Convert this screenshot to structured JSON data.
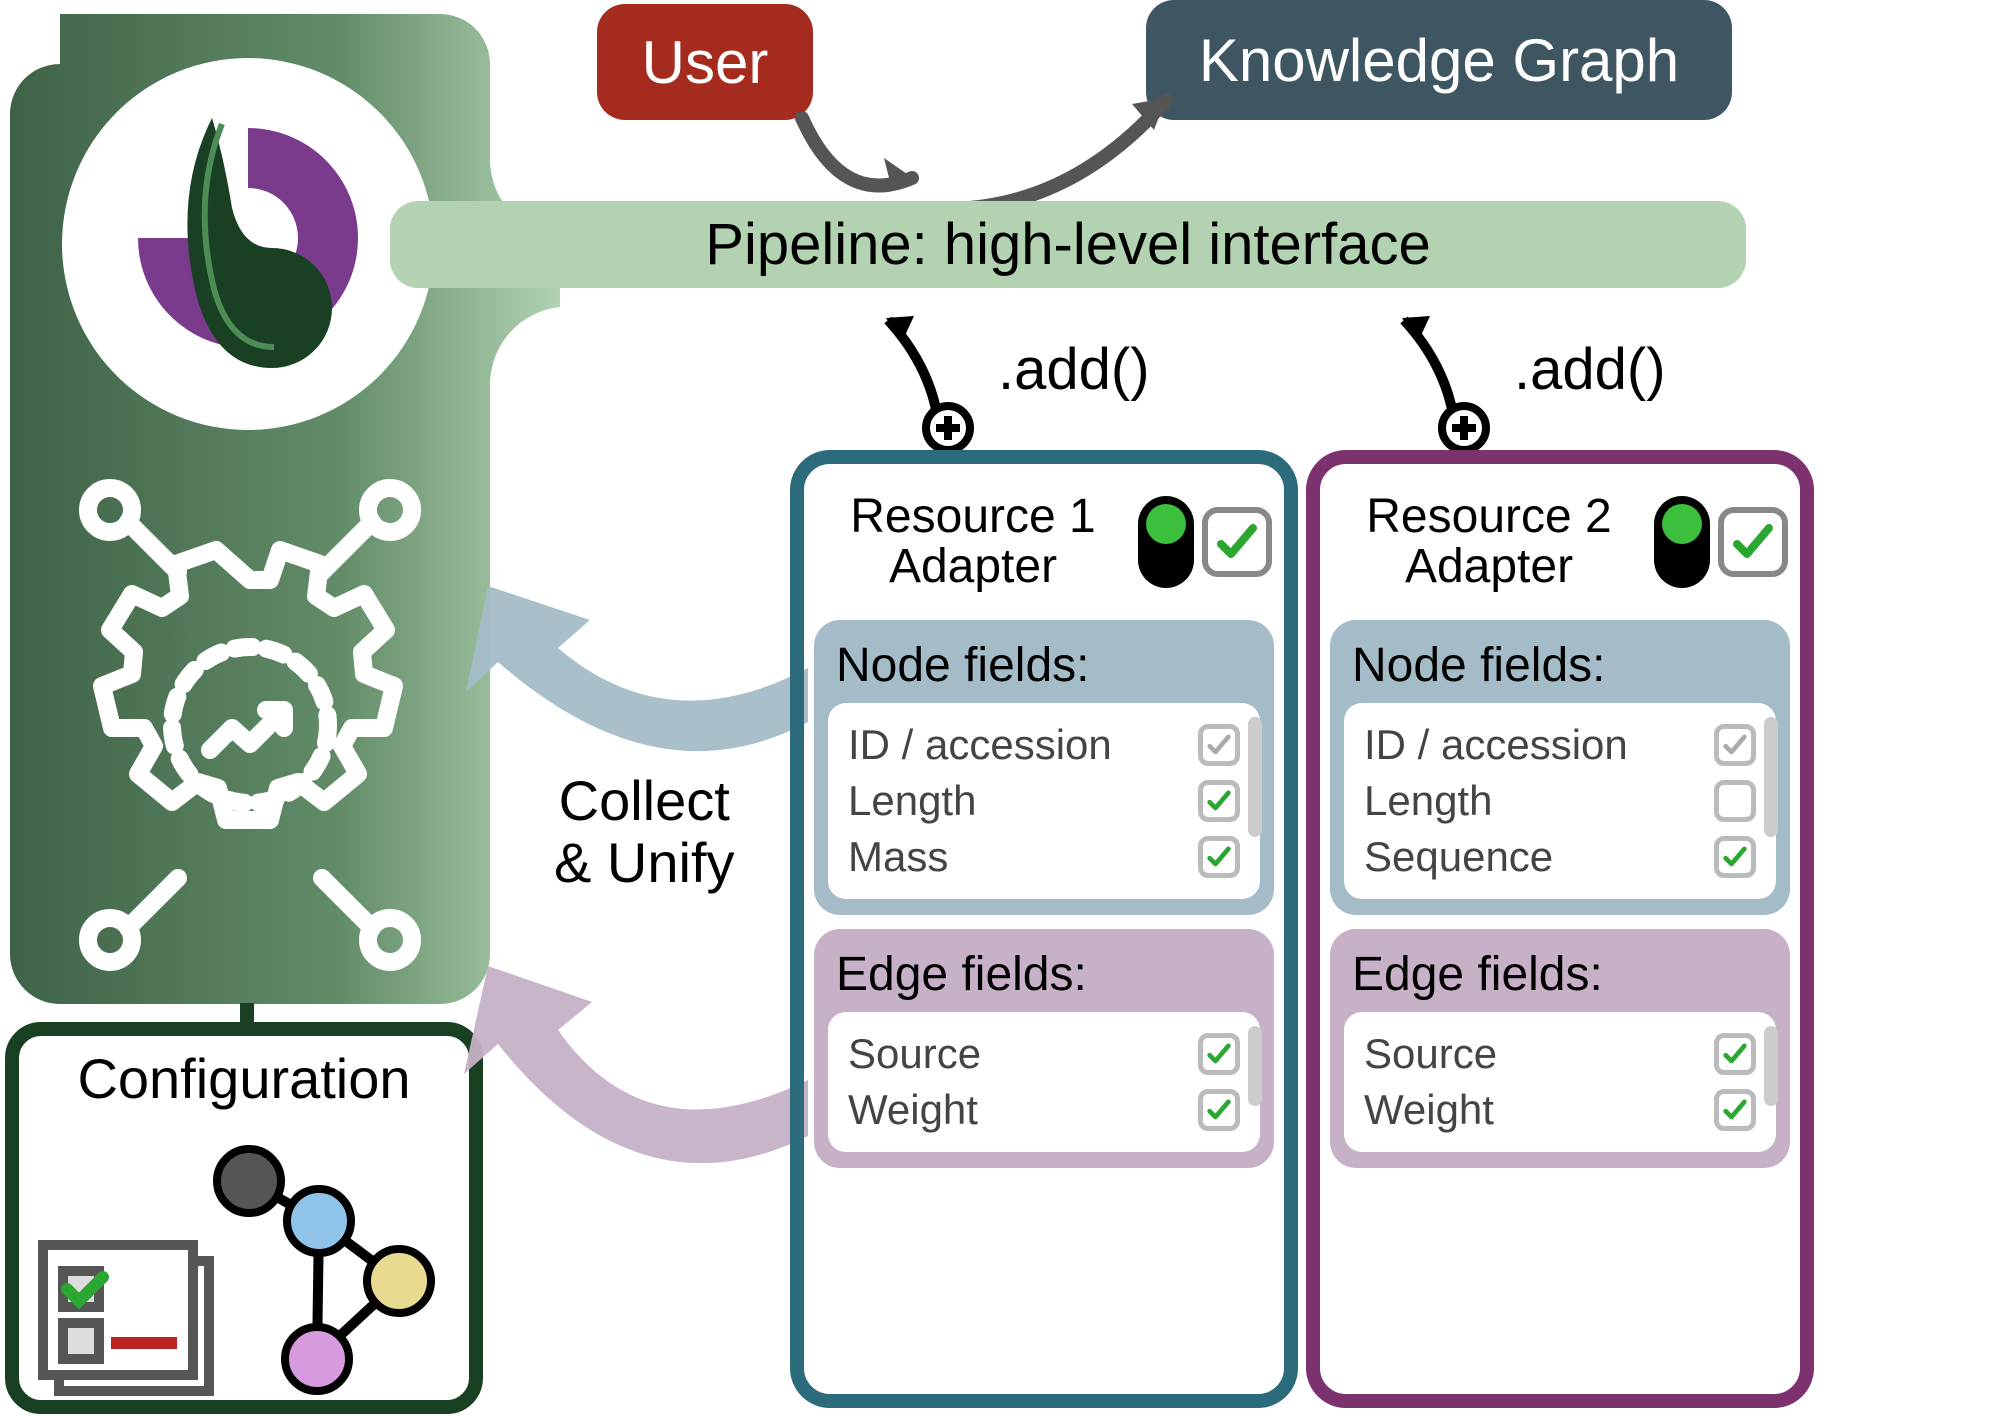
{
  "top": {
    "user_label": "User",
    "kg_label": "Knowledge Graph"
  },
  "pipeline": {
    "label": "Pipeline: high-level interface"
  },
  "add": {
    "label": ".add()"
  },
  "collect": {
    "line1": "Collect",
    "line2": "& Unify"
  },
  "configuration": {
    "title": "Configuration"
  },
  "adapters": [
    {
      "title_line1": "Resource 1",
      "title_line2": "Adapter",
      "toggle_on": true,
      "checked": true,
      "node_section": {
        "title": "Node fields:",
        "fields": [
          {
            "label": "ID / accession",
            "checked": true,
            "gray": true
          },
          {
            "label": "Length",
            "checked": true,
            "gray": false
          },
          {
            "label": "Mass",
            "checked": true,
            "gray": false
          }
        ]
      },
      "edge_section": {
        "title": "Edge fields:",
        "fields": [
          {
            "label": "Source",
            "checked": true,
            "gray": false
          },
          {
            "label": "Weight",
            "checked": true,
            "gray": false
          }
        ]
      }
    },
    {
      "title_line1": "Resource 2",
      "title_line2": "Adapter",
      "toggle_on": true,
      "checked": true,
      "node_section": {
        "title": "Node fields:",
        "fields": [
          {
            "label": "ID / accession",
            "checked": true,
            "gray": true
          },
          {
            "label": "Length",
            "checked": false,
            "gray": false
          },
          {
            "label": "Sequence",
            "checked": true,
            "gray": false
          }
        ]
      },
      "edge_section": {
        "title": "Edge fields:",
        "fields": [
          {
            "label": "Source",
            "checked": true,
            "gray": false
          },
          {
            "label": "Weight",
            "checked": true,
            "gray": false
          }
        ]
      }
    }
  ],
  "colors": {
    "green_dark": "#1a4024",
    "green_mid": "#5c8362",
    "green_light": "#b2d2b2",
    "teal": "#2c6b7c",
    "purple": "#7d3270",
    "node_bg": "#a4bcc7",
    "edge_bg": "#c6b1c6",
    "user_bg": "#a52b1f",
    "kg_bg": "#3e5662",
    "check_green": "#2aa631"
  }
}
